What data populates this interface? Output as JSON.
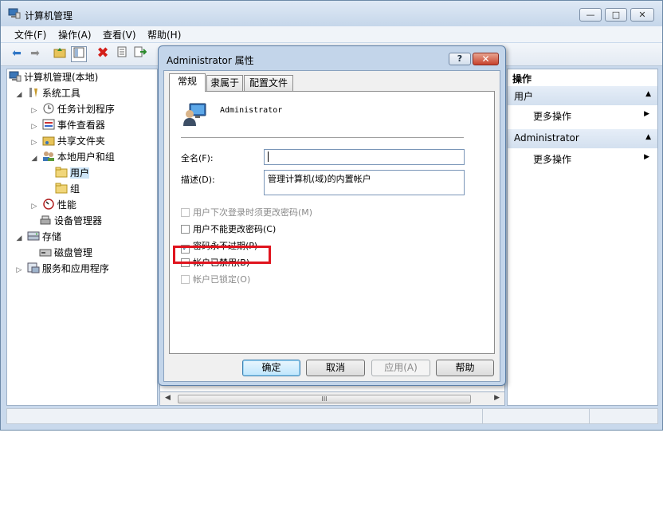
{
  "window": {
    "title": "计算机管理",
    "controls": {
      "minimize": "—",
      "maximize": "□",
      "close": "✕"
    }
  },
  "menu": [
    "文件(F)",
    "操作(A)",
    "查看(V)",
    "帮助(H)"
  ],
  "toolbar": {
    "icons": [
      "back-arrow-icon",
      "forward-arrow-icon",
      "up-folder-icon",
      "show-hide-tree-icon",
      "delete-icon",
      "properties-icon",
      "export-icon"
    ]
  },
  "tree": {
    "root": "计算机管理(本地)",
    "system_tools": "系统工具",
    "task_scheduler": "任务计划程序",
    "event_viewer": "事件查看器",
    "shared_folders": "共享文件夹",
    "local_users_groups": "本地用户和组",
    "users": "用户",
    "groups": "组",
    "performance": "性能",
    "device_manager": "设备管理器",
    "storage": "存储",
    "disk_management": "磁盘管理",
    "services_apps": "服务和应用程序"
  },
  "actions": {
    "header": "操作",
    "section1": "用户",
    "more1": "更多操作",
    "section2": "Administrator",
    "more2": "更多操作"
  },
  "scrollbar": {
    "thumb_grip": "III"
  },
  "dialog": {
    "title": "Administrator 属性",
    "help": "?",
    "close": "✕",
    "tabs": [
      "常规",
      "隶属于",
      "配置文件"
    ],
    "user_name": "Administrator",
    "full_name_label": "全名(F):",
    "full_name_value": "",
    "description_label": "描述(D):",
    "description_value": "管理计算机(域)的内置帐户",
    "checkboxes": [
      {
        "label": "用户下次登录时须更改密码(M)",
        "checked": false,
        "enabled": false
      },
      {
        "label": "用户不能更改密码(C)",
        "checked": false,
        "enabled": true
      },
      {
        "label": "密码永不过期(P)",
        "checked": true,
        "enabled": true
      },
      {
        "label": "帐户已禁用(B)",
        "checked": false,
        "enabled": true
      },
      {
        "label": "帐户已锁定(O)",
        "checked": false,
        "enabled": false
      }
    ],
    "buttons": {
      "ok": "确定",
      "cancel": "取消",
      "apply": "应用(A)",
      "help": "帮助"
    },
    "checkmark": "✓"
  }
}
